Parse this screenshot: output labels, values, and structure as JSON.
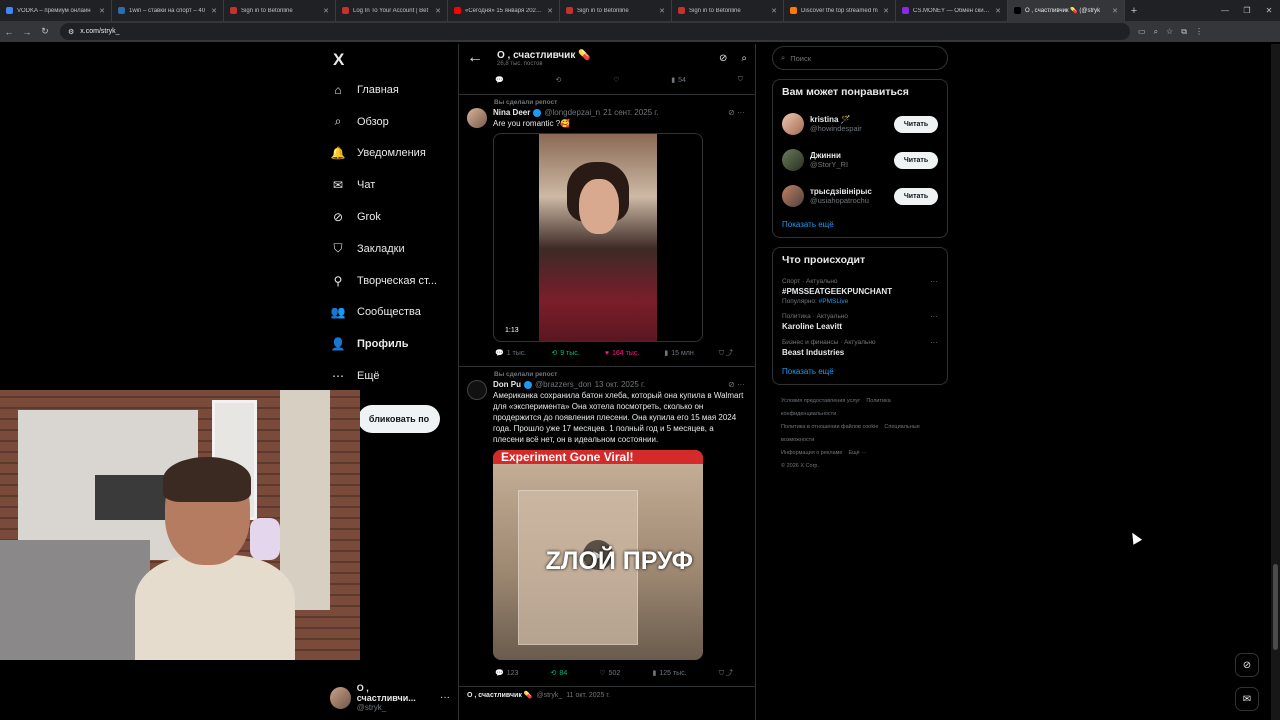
{
  "browser": {
    "tabs": [
      {
        "label": "VODKA – премиум онлайн",
        "color": "#4285f4"
      },
      {
        "label": "1win – ставки на спорт – 40",
        "color": "#2b6cb0"
      },
      {
        "label": "Sign in to Betonline",
        "color": "#c53030"
      },
      {
        "label": "Log In To Your Account | Bet",
        "color": "#c53030"
      },
      {
        "label": "«Сегодня» 15 января 2026 г.",
        "color": "#ff0000"
      },
      {
        "label": "Sign in to Betonline",
        "color": "#c53030"
      },
      {
        "label": "Sign in to Betonline",
        "color": "#c53030"
      },
      {
        "label": "Discover the top streamed m",
        "color": "#ff7a00"
      },
      {
        "label": "CS.MONEY — Обмен скинов",
        "color": "#8a2be2"
      },
      {
        "label": "О , счастливчик 💊 (@stryk",
        "color": "#000000"
      }
    ],
    "url": "x.com/stryk_"
  },
  "nav": {
    "logo": "X",
    "items": [
      {
        "label": "Главная",
        "icon": "home-icon",
        "glyph": "⌂"
      },
      {
        "label": "Обзор",
        "icon": "search-icon",
        "glyph": "⌕"
      },
      {
        "label": "Уведомления",
        "icon": "bell-icon",
        "glyph": "🔔"
      },
      {
        "label": "Чат",
        "icon": "mail-icon",
        "glyph": "✉"
      },
      {
        "label": "Grok",
        "icon": "grok-icon",
        "glyph": "⊘"
      },
      {
        "label": "Закладки",
        "icon": "bookmark-icon",
        "glyph": "⛉"
      },
      {
        "label": "Творческая ст...",
        "icon": "creator-icon",
        "glyph": "⚲"
      },
      {
        "label": "Сообщества",
        "icon": "communities-icon",
        "glyph": "👥"
      },
      {
        "label": "Профиль",
        "icon": "profile-icon",
        "glyph": "👤"
      },
      {
        "label": "Ещё",
        "icon": "more-icon",
        "glyph": "⋯"
      }
    ],
    "post_button": "бликовать по",
    "account": {
      "name": "О , счастливчи...",
      "handle": "@stryk_"
    }
  },
  "header": {
    "title": "О , счастливчик 💊",
    "subtitle": "26,8 тыс. постов"
  },
  "top_actions": {
    "views": "54"
  },
  "posts": [
    {
      "repost_label": "Вы сделали репост",
      "name": "Nina Deer",
      "handle": "@longdepzai_n",
      "date": "21 сент. 2025 г.",
      "text": "Are you romantic ?🥰",
      "duration": "1:13",
      "replies": "1 тыс.",
      "reposts": "9 тыс.",
      "likes": "164 тыс.",
      "views": "15 млн"
    },
    {
      "repost_label": "Вы сделали репост",
      "name": "Don Pu",
      "handle": "@brazzers_don",
      "date": "13 окт. 2025 г.",
      "text": "Американка сохранила батон хлеба, который она купила в Walmart для «эксперимента» Она хотела посмотреть, сколько он продержится до появления плесени. Она купила его 15 мая 2024 года. Прошло уже 17 месяцев. 1 полный год и 5 месяцев, а плесени всё нет, он в идеальном состоянии.",
      "banner": "Experiment Gone Viral!",
      "watermark": "ZЛОЙ ПРУФ",
      "replies": "123",
      "reposts": "84",
      "likes": "502",
      "views": "125 тыс."
    }
  ],
  "next_post": {
    "name": "О , счастливчик 💊",
    "handle": "@stryk_",
    "date": "11 окт. 2025 г."
  },
  "right": {
    "search_placeholder": "Поиск",
    "who_title": "Вам может понравиться",
    "who": [
      {
        "name": "kristina 🪄",
        "handle": "@howindespair",
        "button": "Читать"
      },
      {
        "name": "Джинни",
        "handle": "@StorY_RI",
        "button": "Читать"
      },
      {
        "name": "трысдзівінірыс",
        "handle": "@usiahopatrochu",
        "button": "Читать"
      }
    ],
    "show_more": "Показать ещё",
    "trends_title": "Что происходит",
    "trends": [
      {
        "category": "Спорт · Актуально",
        "name": "#PMSSEATGEEKPUNCHANT",
        "popular_label": "Популярно:",
        "popular_tag": "#PMSLive"
      },
      {
        "category": "Политика · Актуально",
        "name": "Karoline Leavitt"
      },
      {
        "category": "Бизнес и финансы · Актуально",
        "name": "Beast Industries"
      }
    ],
    "footer": [
      "Условия предоставления услуг",
      "Политика конфиденциальности",
      "Политика в отношении файлов cookie",
      "Специальные возможности",
      "Информация о рекламе",
      "Ещё ···",
      "© 2026 X Corp."
    ]
  },
  "colors": {
    "accent": "#1d9bf0",
    "repost": "#00ba7c",
    "like": "#f91880"
  }
}
